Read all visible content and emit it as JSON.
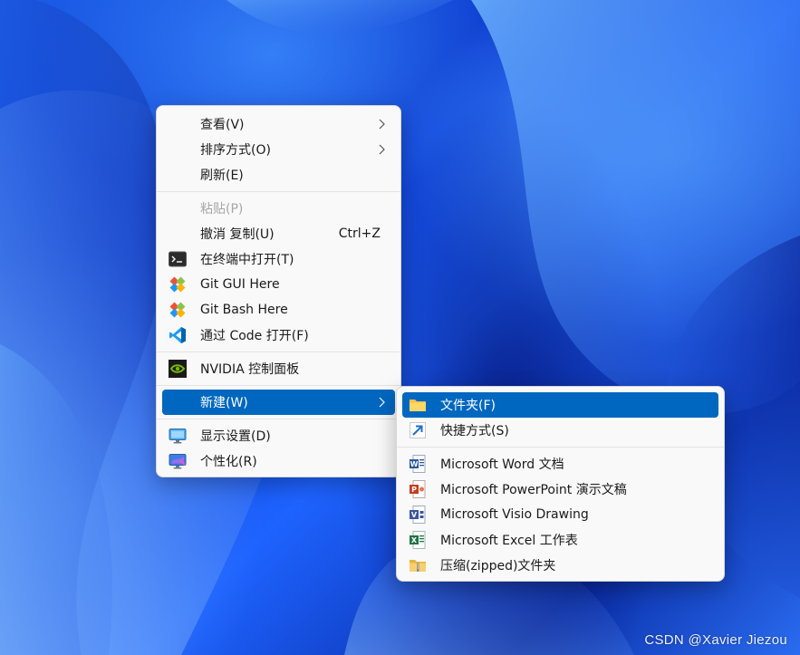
{
  "context_menu": {
    "items": [
      {
        "label": "查看(V)",
        "submenu": true
      },
      {
        "label": "排序方式(O)",
        "submenu": true
      },
      {
        "label": "刷新(E)"
      },
      {
        "label": "粘贴(P)",
        "disabled": true
      },
      {
        "label": "撤消 复制(U)",
        "shortcut": "Ctrl+Z"
      },
      {
        "label": "在终端中打开(T)",
        "icon": "terminal-icon"
      },
      {
        "label": "Git GUI Here",
        "icon": "git-gui-icon"
      },
      {
        "label": "Git Bash Here",
        "icon": "git-bash-icon"
      },
      {
        "label": "通过 Code 打开(F)",
        "icon": "vscode-icon"
      },
      {
        "label": "NVIDIA 控制面板",
        "icon": "nvidia-icon"
      },
      {
        "label": "新建(W)",
        "submenu": true,
        "selected": true
      },
      {
        "label": "显示设置(D)",
        "icon": "display-settings-icon"
      },
      {
        "label": "个性化(R)",
        "icon": "personalize-icon"
      }
    ]
  },
  "new_submenu": {
    "items": [
      {
        "label": "文件夹(F)",
        "icon": "folder-icon",
        "selected": true
      },
      {
        "label": "快捷方式(S)",
        "icon": "shortcut-icon"
      },
      {
        "label": "Microsoft Word 文档",
        "icon": "word-icon"
      },
      {
        "label": "Microsoft PowerPoint 演示文稿",
        "icon": "powerpoint-icon"
      },
      {
        "label": "Microsoft Visio Drawing",
        "icon": "visio-icon"
      },
      {
        "label": "Microsoft Excel 工作表",
        "icon": "excel-icon"
      },
      {
        "label": "压缩(zipped)文件夹",
        "icon": "zip-folder-icon"
      }
    ]
  },
  "watermark": "CSDN @Xavier Jiezou",
  "colors": {
    "selection": "#0067c0",
    "menu_background": "#f9f9f9",
    "disabled_text": "#a6a6a6"
  }
}
